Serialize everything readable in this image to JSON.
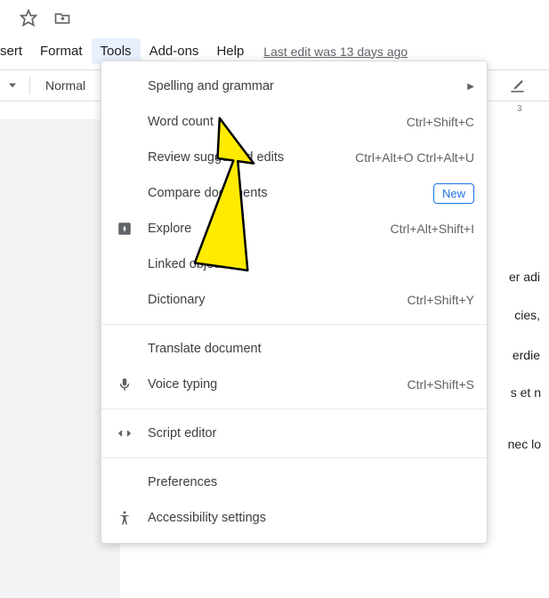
{
  "menu": {
    "insert": "sert",
    "format": "Format",
    "tools": "Tools",
    "addons": "Add-ons",
    "help": "Help",
    "edit_status": "Last edit was 13 days ago"
  },
  "toolbar": {
    "style": "Normal"
  },
  "ruler": {
    "tick3": "3"
  },
  "dropdown": {
    "spelling": "Spelling and grammar",
    "word_count": {
      "label": "Word count",
      "shortcut": "Ctrl+Shift+C"
    },
    "review": {
      "label": "Review suggested edits",
      "shortcut": "Ctrl+Alt+O Ctrl+Alt+U"
    },
    "compare": {
      "label": "Compare documents",
      "badge": "New"
    },
    "explore": {
      "label": "Explore",
      "shortcut": "Ctrl+Alt+Shift+I"
    },
    "linked": "Linked objects",
    "dictionary": {
      "label": "Dictionary",
      "shortcut": "Ctrl+Shift+Y"
    },
    "translate": "Translate document",
    "voice": {
      "label": "Voice typing",
      "shortcut": "Ctrl+Shift+S"
    },
    "script": "Script editor",
    "prefs": "Preferences",
    "accessibility": "Accessibility settings"
  },
  "doc": {
    "f1": "er adi",
    "f2": "cies,",
    "f3": "erdie",
    "f4": "s et n",
    "f5": "nec lo"
  }
}
